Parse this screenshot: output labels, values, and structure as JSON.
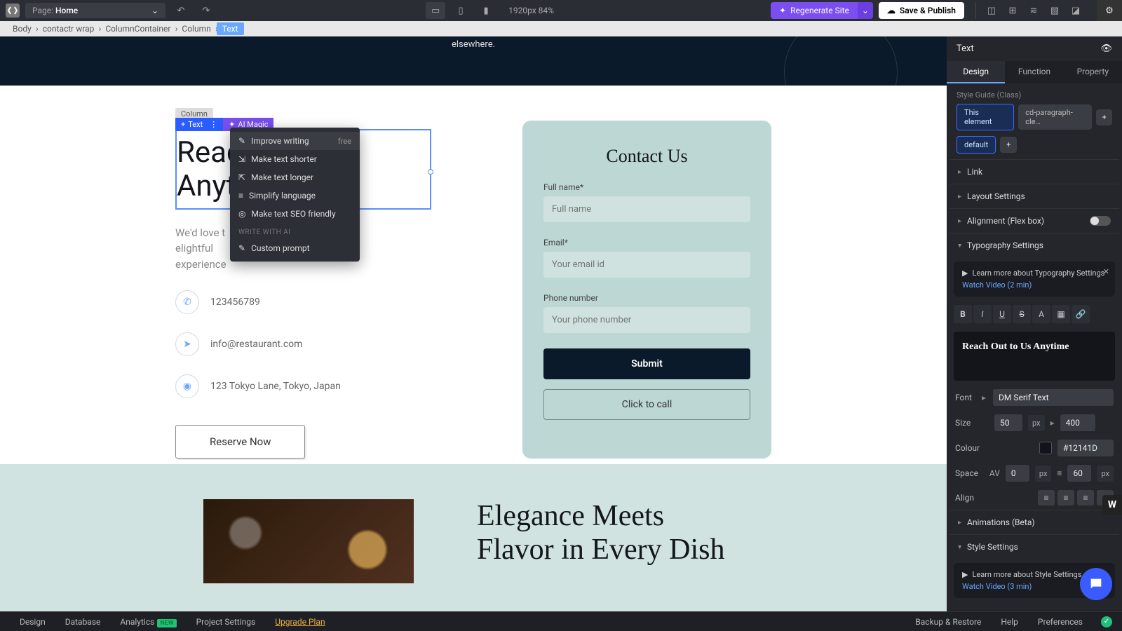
{
  "topbar": {
    "page_label": "Page:",
    "page_value": "Home",
    "zoom": "1920px  84%",
    "regenerate": "Regenerate Site",
    "save": "Save & Publish"
  },
  "breadcrumb": [
    "Body",
    "contactr wrap",
    "ColumnContainer",
    "Column",
    "Text"
  ],
  "canvas": {
    "top_strip": "elsewhere.",
    "column_tag": "Column",
    "text_tag": "Text",
    "ai_magic": "AI Magic",
    "heading_l1": "Reac",
    "heading_l2": "Anyt",
    "subtext_l1": "We'd love t",
    "subtext_l2": "experience",
    "subtext_tail": "elightful",
    "phone": "123456789",
    "email": "info@restaurant.com",
    "address": "123 Tokyo Lane, Tokyo, Japan",
    "reserve": "Reserve Now",
    "ai_menu": {
      "improve": "Improve writing",
      "free": "free",
      "shorter": "Make text shorter",
      "longer": "Make text longer",
      "simplify": "Simplify language",
      "seo": "Make text SEO friendly",
      "divider": "WRITE WITH AI",
      "custom": "Custom prompt"
    },
    "contact": {
      "title": "Contact Us",
      "fullname_label": "Full name*",
      "fullname_ph": "Full name",
      "email_label": "Email*",
      "email_ph": "Your email id",
      "phone_label": "Phone number",
      "phone_ph": "Your phone number",
      "submit": "Submit",
      "call": "Click to call"
    },
    "bottom_heading": "Elegance Meets Flavor in Every Dish"
  },
  "panel": {
    "title": "Text",
    "tabs": {
      "design": "Design",
      "function": "Function",
      "property": "Property"
    },
    "style_guide": "Style Guide (Class)",
    "this_element": "This element",
    "class2": "cd-paragraph-cle…",
    "default": "default",
    "link": "Link",
    "layout": "Layout Settings",
    "alignment": "Alignment (Flex box)",
    "typography": "Typography Settings",
    "tip_text": "Learn more about Typography Settings",
    "tip_link": "Watch Video (2 min)",
    "preview": "Reach Out to Us Anytime",
    "font_label": "Font",
    "font_value": "DM Serif Text",
    "size_label": "Size",
    "size_value": "50",
    "size_unit": "px",
    "weight_value": "400",
    "colour_label": "Colour",
    "colour_value": "#12141D",
    "space_label": "Space",
    "letter_value": "0",
    "letter_unit": "px",
    "line_value": "60",
    "line_unit": "px",
    "align_label": "Align",
    "animations": "Animations (Beta)",
    "style_settings": "Style Settings",
    "tip2_text": "Learn more about Style Settings",
    "tip2_link": "Watch Video (3 min)"
  },
  "bottombar": {
    "design": "Design",
    "database": "Database",
    "analytics": "Analytics",
    "new": "NEW",
    "project": "Project Settings",
    "upgrade": "Upgrade Plan",
    "backup": "Backup & Restore",
    "help": "Help",
    "prefs": "Preferences"
  }
}
